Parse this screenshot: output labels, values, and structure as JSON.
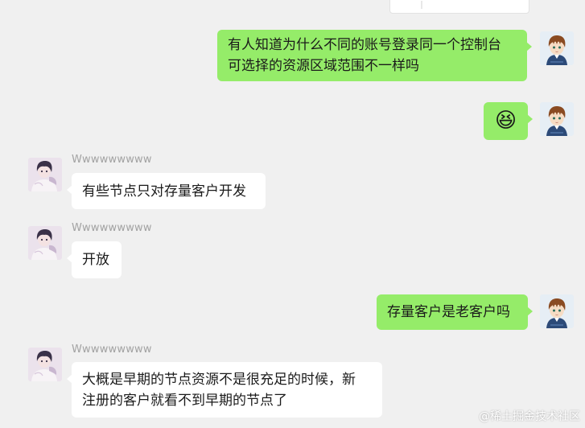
{
  "messages": [
    {
      "side": "right",
      "kind": "text",
      "text": "有人知道为什么不同的账号登录同一个控制台\n可选择的资源区域范围不一样吗"
    },
    {
      "side": "right",
      "kind": "emoji",
      "emoji": "😆"
    },
    {
      "side": "left",
      "kind": "text",
      "sender": "Wwwwwwwww",
      "text": "有些节点只对存量客户开发"
    },
    {
      "side": "left",
      "kind": "text",
      "sender": "Wwwwwwwww",
      "text": "开放"
    },
    {
      "side": "right",
      "kind": "text",
      "text": "存量客户是老客户吗"
    },
    {
      "side": "left",
      "kind": "text",
      "sender": "Wwwwwwwww",
      "text": "大概是早期的节点资源不是很充足的时候，新\n注册的客户就看不到早期的节点了"
    }
  ],
  "watermark": "@稀土掘金技术社区",
  "colors": {
    "background": "#f0f0f0",
    "bubble_self": "#95ec69",
    "bubble_other": "#ffffff",
    "sender_name": "#a2a2a2"
  }
}
